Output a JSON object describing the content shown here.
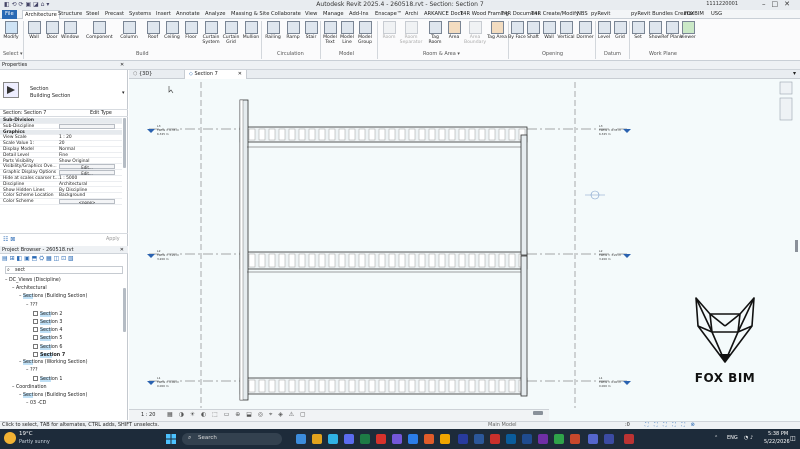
{
  "window": {
    "title": "Autodesk Revit 2025.4 - 260518.rvt - Section: Section 7",
    "user": "1111220001"
  },
  "ribbon_tabs": [
    "File",
    "Architecture",
    "Structure",
    "Steel",
    "Precast",
    "Systems",
    "Insert",
    "Annotate",
    "Analyze",
    "Massing & Site",
    "Collaborate",
    "View",
    "Manage",
    "Add-Ins",
    "Enscape™",
    "Archi",
    "ARKANCE Dock",
    "T4R Wood Framing",
    "T4R Document",
    "T4R Create/Modify",
    "NBS",
    "pyRevit",
    "pyRevit Bundles Creator",
    "FOXBIM",
    "USG"
  ],
  "ribbon_buttons": {
    "modify": "Modify",
    "wall": "Wall",
    "door": "Door",
    "window": "Window",
    "component": "Component",
    "column": "Column",
    "roof": "Roof",
    "ceiling": "Ceiling",
    "floor": "Floor",
    "curtain_system": "Curtain System",
    "curtain_grid": "Curtain Grid",
    "mullion": "Mullion",
    "railing": "Railing",
    "ramp": "Ramp",
    "stair": "Stair",
    "model_text": "Model Text",
    "model_line": "Model Line",
    "model_group": "Model Group",
    "room": "Room",
    "room_separator": "Room Separator",
    "tag_room": "Tag Room",
    "area": "Area",
    "area_boundary": "Area Boundary",
    "tag_area": "Tag Area",
    "by_face": "By Face",
    "shaft": "Shaft",
    "wall_opening": "Wall",
    "vertical": "Vertical",
    "dormer": "Dormer",
    "level": "Level",
    "grid": "Grid",
    "set": "Set",
    "show": "Show",
    "ref_plane": "Ref Plane",
    "viewer": "Viewer"
  },
  "ribbon_groups": {
    "select": "Select ▾",
    "build": "Build",
    "circulation": "Circulation",
    "model": "Model",
    "room_area": "Room & Area ▾",
    "opening": "Opening",
    "datum": "Datum",
    "work_plane": "Work Plane"
  },
  "properties": {
    "header": "Properties",
    "type_name": "Section",
    "type_sub": "Building Section",
    "instance": "Section: Section 7",
    "edit_type": "Edit Type",
    "rows": [
      {
        "k": "Sub-Division",
        "v": "",
        "cat": true
      },
      {
        "k": "Sub-Discipline",
        "v": "",
        "box": true
      },
      {
        "k": "Graphics",
        "v": "",
        "cat": true
      },
      {
        "k": "View Scale",
        "v": "1 : 20"
      },
      {
        "k": "Scale Value    1:",
        "v": "20"
      },
      {
        "k": "Display Model",
        "v": "Normal"
      },
      {
        "k": "Detail Level",
        "v": "Fine"
      },
      {
        "k": "Parts Visibility",
        "v": "Show Original"
      },
      {
        "k": "Visibility/Graphics Ove...",
        "v": "Edit...",
        "btn": true
      },
      {
        "k": "Graphic Display Options",
        "v": "Edit...",
        "btn": true
      },
      {
        "k": "Hide at scales coarser t...",
        "v": "1 : 5000"
      },
      {
        "k": "Discipline",
        "v": "Architectural"
      },
      {
        "k": "Show Hidden Lines",
        "v": "By Discipline"
      },
      {
        "k": "Color Scheme Location",
        "v": "Background"
      },
      {
        "k": "Color Scheme",
        "v": "<none>",
        "btn": true
      }
    ],
    "apply": "Apply"
  },
  "project_browser": {
    "header": "Project Browser - 260518.rvt",
    "search": "sect",
    "items": [
      {
        "indent": 0,
        "pre": "□ ",
        "t": "",
        "hl": "",
        "post": "",
        "plain": "DC_Views (Discipline)"
      },
      {
        "indent": 1,
        "pre": "",
        "t": "",
        "hl": "",
        "post": "",
        "plain": "Architectural"
      },
      {
        "indent": 2,
        "pre": "",
        "t": "",
        "hl": "Sect",
        "post": "ions (Building Section)",
        "plain": ""
      },
      {
        "indent": 3,
        "pre": "",
        "t": "",
        "hl": "",
        "post": "",
        "plain": "???"
      },
      {
        "indent": 4,
        "pre": "",
        "t": "",
        "hl": "Sect",
        "post": "ion 2",
        "plain": "",
        "chk": true
      },
      {
        "indent": 4,
        "pre": "",
        "t": "",
        "hl": "Sect",
        "post": "ion 3",
        "plain": "",
        "chk": true
      },
      {
        "indent": 4,
        "pre": "",
        "t": "",
        "hl": "Sect",
        "post": "ion 4",
        "plain": "",
        "chk": true
      },
      {
        "indent": 4,
        "pre": "",
        "t": "",
        "hl": "Sect",
        "post": "ion 5",
        "plain": "",
        "chk": true
      },
      {
        "indent": 4,
        "pre": "",
        "t": "",
        "hl": "Sect",
        "post": "ion 6",
        "plain": "",
        "chk": true
      },
      {
        "indent": 4,
        "pre": "",
        "t": "",
        "hl": "Sect",
        "post": "ion 7",
        "plain": "",
        "chk": true,
        "bold": true
      },
      {
        "indent": 2,
        "pre": "",
        "t": "",
        "hl": "Sect",
        "post": "ions (Working Section)",
        "plain": ""
      },
      {
        "indent": 3,
        "pre": "",
        "t": "",
        "hl": "",
        "post": "",
        "plain": "???"
      },
      {
        "indent": 4,
        "pre": "",
        "t": "",
        "hl": "Sect",
        "post": "ion 1",
        "plain": "",
        "chk": true
      },
      {
        "indent": 1,
        "pre": "",
        "t": "",
        "hl": "",
        "post": "",
        "plain": "Coordination"
      },
      {
        "indent": 2,
        "pre": "",
        "t": "",
        "hl": "Sect",
        "post": "ions (Building Section)",
        "plain": ""
      },
      {
        "indent": 3,
        "pre": "",
        "t": "",
        "hl": "",
        "post": "",
        "plain": "03 -CD"
      }
    ]
  },
  "doc_tabs": [
    {
      "label": "{3D}",
      "active": false
    },
    {
      "label": "Section 7",
      "active": true
    }
  ],
  "levels": [
    {
      "name": "L3",
      "value": "FREW = 6.35 m",
      "sub": "6.325 m"
    },
    {
      "name": "L2",
      "value": "FREW = 3.20 m",
      "sub": "3.200 m"
    },
    {
      "name": "L1",
      "value": "FREW = 0.00 m",
      "sub": "0.000 m"
    }
  ],
  "view_control": {
    "scale": "1 : 20"
  },
  "status": {
    "message": "Click to select, TAB for alternates, CTRL adds, SHIFT unselects.",
    "model": "Main Model",
    "zero": ":0"
  },
  "logo_text": "FOX BIM",
  "taskbar": {
    "weather_temp": "19°C",
    "weather_desc": "Partly sunny",
    "search": "Search",
    "lang": "ENG",
    "time": "5:38 PM",
    "date": "5/22/2026"
  }
}
